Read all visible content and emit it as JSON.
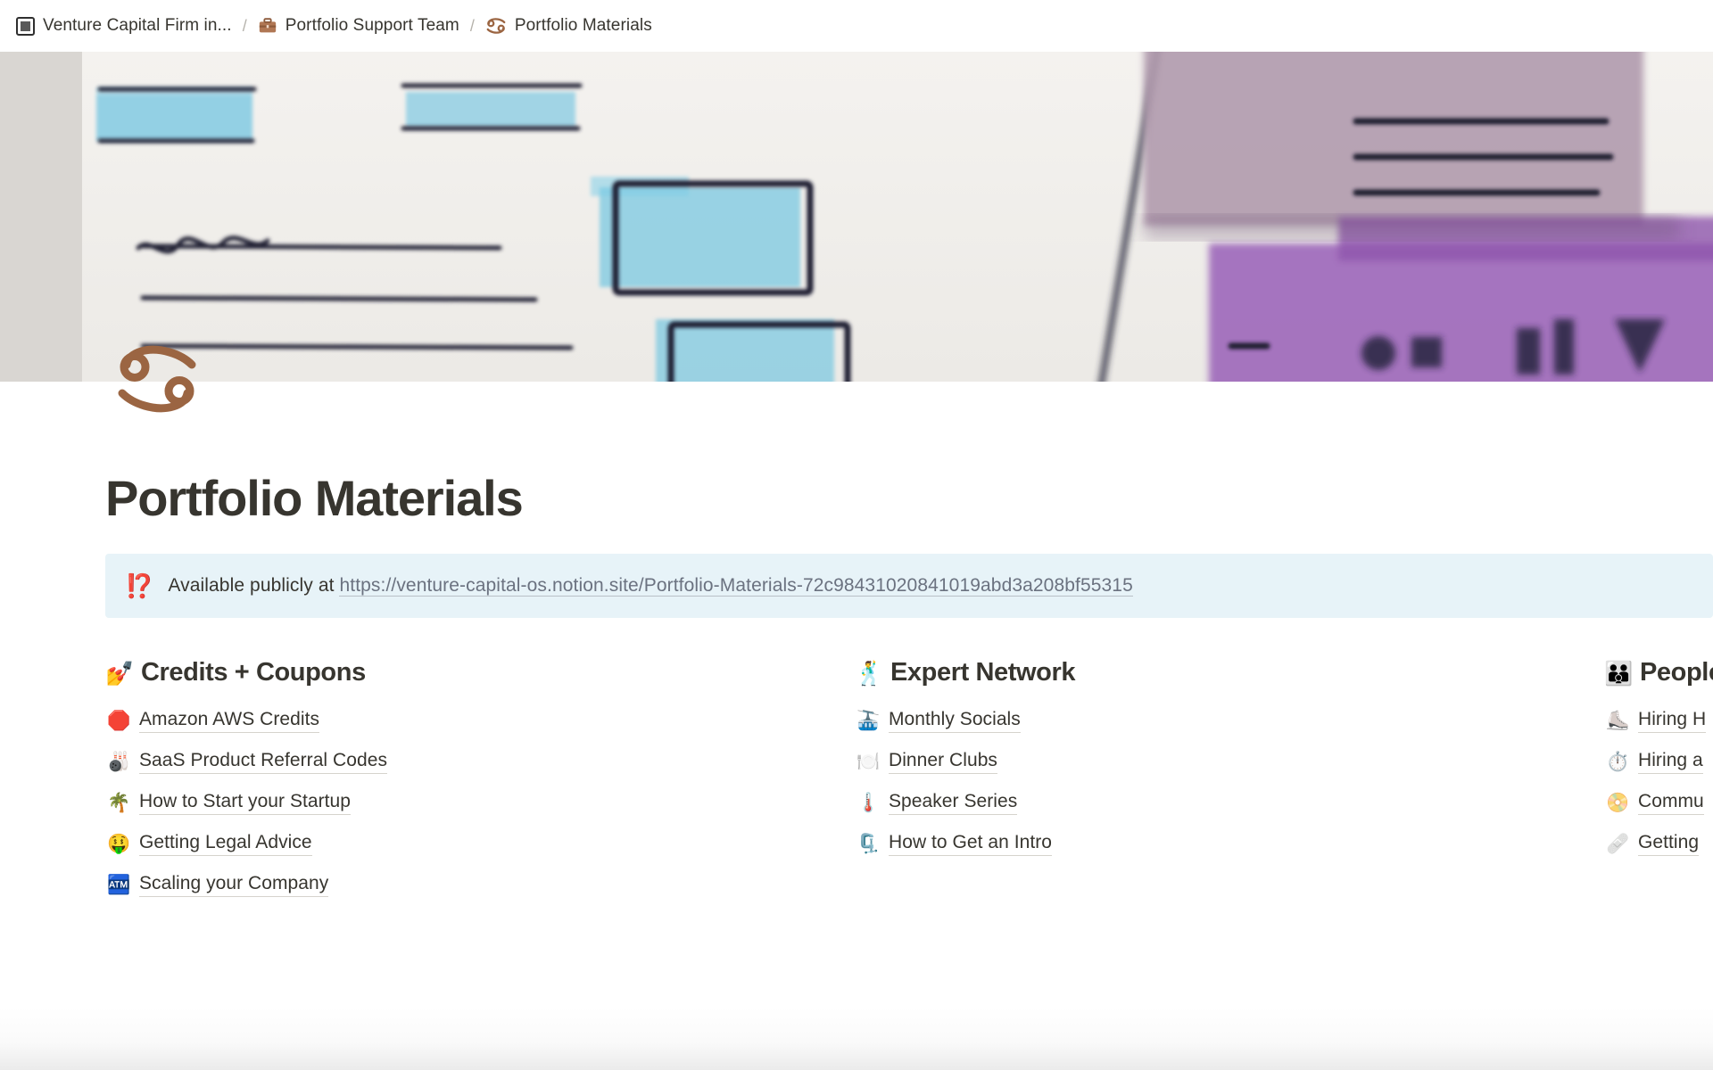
{
  "breadcrumb": {
    "items": [
      {
        "icon": "framed-square-icon",
        "label": "Venture Capital Firm in..."
      },
      {
        "icon": "briefcase-icon",
        "label": "Portfolio Support Team"
      },
      {
        "icon": "cancer-zodiac-icon",
        "label": "Portfolio Materials"
      }
    ],
    "separator": "/"
  },
  "page": {
    "icon": "cancer-zodiac-icon",
    "icon_color": "#9b6542",
    "title": "Portfolio Materials",
    "cover_alt": "watercolor wireframe sketch"
  },
  "callout": {
    "emoji": "⁉️",
    "emoji_name": "exclamation-question-mark",
    "text_prefix": "Available publicly at",
    "link_text": "https://venture-capital-os.notion.site/Portfolio-Materials-72c98431020841019abd3a208bf55315",
    "background": "#e7f3f8"
  },
  "columns": [
    {
      "heading_emoji": "💅",
      "heading_emoji_name": "nail-polish-emoji",
      "heading": "Credits + Coupons",
      "links": [
        {
          "emoji": "🛑",
          "emoji_name": "stop-sign-emoji",
          "label": "Amazon AWS Credits"
        },
        {
          "emoji": "🎳",
          "emoji_name": "bowling-emoji",
          "label": "SaaS Product Referral Codes"
        },
        {
          "emoji": "🌴",
          "emoji_name": "palm-tree-emoji",
          "label": "How to Start your Startup"
        },
        {
          "emoji": "🤑",
          "emoji_name": "money-mouth-face-emoji",
          "label": "Getting Legal Advice"
        },
        {
          "emoji": "🏧",
          "emoji_name": "atm-sign-emoji",
          "label": "Scaling your Company"
        }
      ]
    },
    {
      "heading_emoji": "🕺",
      "heading_emoji_name": "man-dancing-emoji",
      "heading": "Expert Network",
      "links": [
        {
          "emoji": "🚠",
          "emoji_name": "mountain-cableway-emoji",
          "label": "Monthly Socials"
        },
        {
          "emoji": "🍽️",
          "emoji_name": "fork-and-knife-with-plate-emoji",
          "label": "Dinner Clubs"
        },
        {
          "emoji": "🌡️",
          "emoji_name": "thermometer-emoji",
          "label": "Speaker Series"
        },
        {
          "emoji": "🗜️",
          "emoji_name": "clamp-emoji",
          "label": "How to Get an Intro"
        }
      ]
    },
    {
      "heading_emoji": "👪",
      "heading_emoji_name": "family-emoji",
      "heading": "People",
      "links": [
        {
          "emoji": "⛸️",
          "emoji_name": "ice-skate-emoji",
          "label": "Hiring H"
        },
        {
          "emoji": "⏱️",
          "emoji_name": "stopwatch-emoji",
          "label": "Hiring a"
        },
        {
          "emoji": "📀",
          "emoji_name": "dvd-emoji",
          "label": "Commu"
        },
        {
          "emoji": "🩹",
          "emoji_name": "adhesive-bandage-emoji",
          "label": "Getting"
        }
      ]
    }
  ]
}
